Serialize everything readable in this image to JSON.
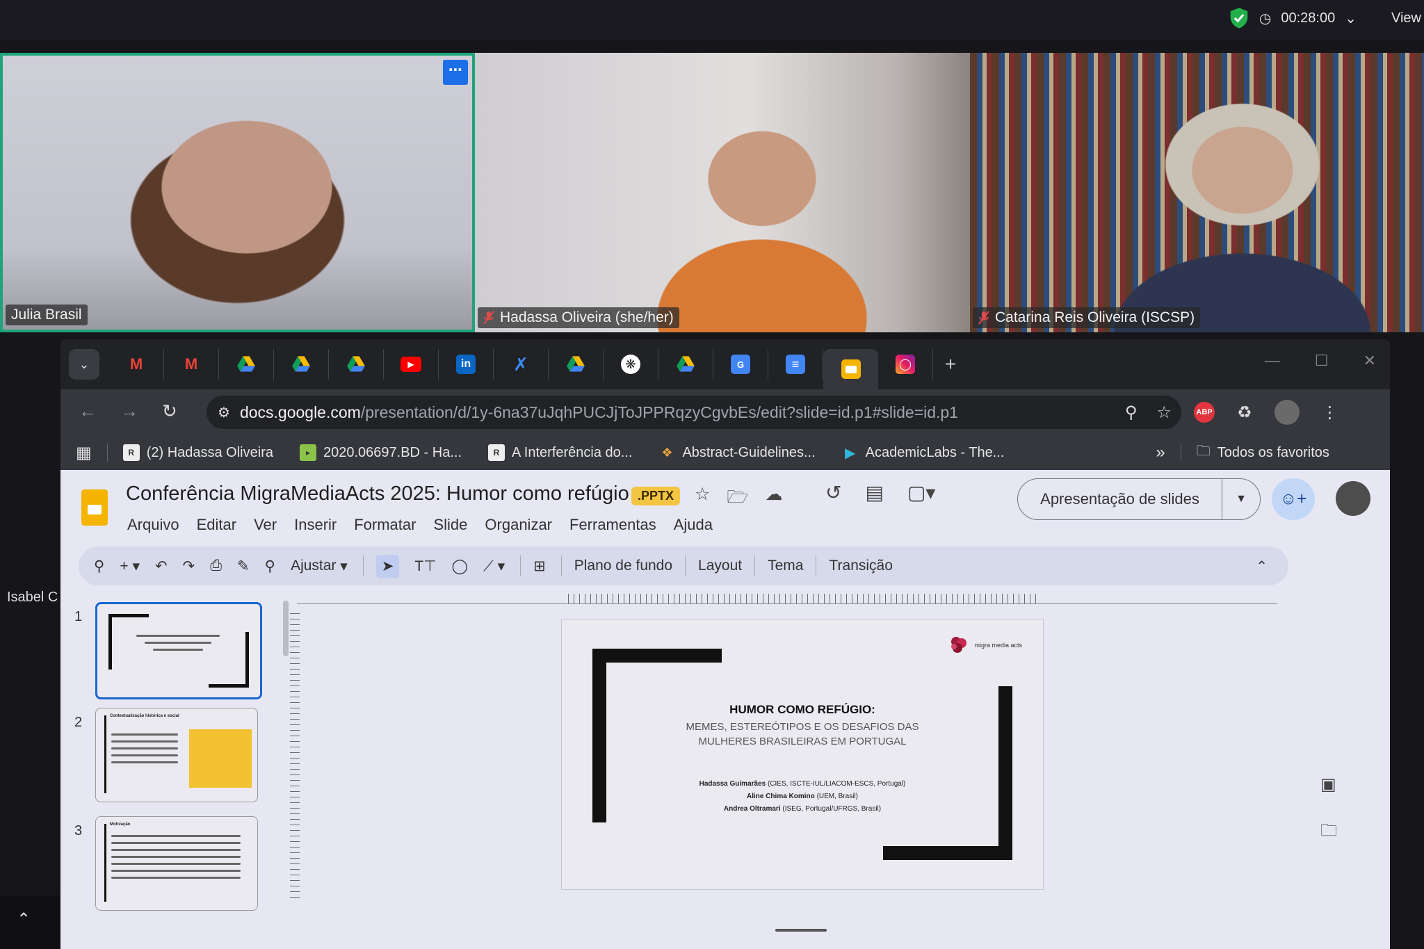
{
  "meeting": {
    "timer": "00:28:00",
    "view_label": "View",
    "participants": [
      {
        "name": "Julia Brasil"
      },
      {
        "name": "Hadassa Oliveira (she/her)"
      },
      {
        "name": "Catarina Reis Oliveira (ISCSP)"
      }
    ],
    "offscreen_participant": "Isabel C",
    "colors": {
      "active_border": "#1fa37a",
      "menu_button": "#1c6fe8"
    }
  },
  "browser": {
    "url_host": "docs.google.com",
    "url_path": "/presentation/d/1y-6na37uJqhPUCJjToJPPRqzyCgvbEs/edit?slide=id.p1#slide=id.p1",
    "tabs": [
      {
        "icon": "gmail-icon"
      },
      {
        "icon": "gmail-icon"
      },
      {
        "icon": "drive-icon"
      },
      {
        "icon": "drive-icon"
      },
      {
        "icon": "drive-icon"
      },
      {
        "icon": "youtube-icon"
      },
      {
        "icon": "linkedin-icon"
      },
      {
        "icon": "confluence-icon"
      },
      {
        "icon": "drive-icon"
      },
      {
        "icon": "chatgpt-icon"
      },
      {
        "icon": "drive-icon"
      },
      {
        "icon": "translate-icon"
      },
      {
        "icon": "docs-icon"
      },
      {
        "icon": "slides-icon",
        "active": true
      },
      {
        "icon": "instagram-icon"
      }
    ],
    "extension_abp": "ABP",
    "bookmarks": [
      {
        "label": "(2) Hadassa Oliveira"
      },
      {
        "label": "2020.06697.BD - Ha..."
      },
      {
        "label": "A Interferência do..."
      },
      {
        "label": "Abstract-Guidelines..."
      },
      {
        "label": "AcademicLabs - The..."
      }
    ],
    "all_bookmarks": "Todos os favoritos"
  },
  "docs": {
    "title": "Conferência MigraMediaActs 2025: Humor como refúgio",
    "badge": ".PPTX",
    "menu": [
      "Arquivo",
      "Editar",
      "Ver",
      "Inserir",
      "Formatar",
      "Slide",
      "Organizar",
      "Ferramentas",
      "Ajuda"
    ],
    "present_label": "Apresentação de slides",
    "toolbar": {
      "zoom_label": "Ajustar",
      "items": [
        "Plano de fundo",
        "Layout",
        "Tema",
        "Transição"
      ]
    },
    "thumbnails": [
      {
        "number": "1"
      },
      {
        "number": "2",
        "title": "Contextualização histórica e social"
      },
      {
        "number": "3",
        "title": "Motivação"
      }
    ],
    "slide": {
      "logo_text": "migra media acts",
      "title": "HUMOR COMO REFÚGIO:",
      "subtitle_line1": "MEMES, ESTEREÓTIPOS E OS DESAFIOS DAS",
      "subtitle_line2": "MULHERES BRASILEIRAS EM PORTUGAL",
      "authors": [
        {
          "name": "Hadassa Guimarães",
          "affiliation": "(CIES, ISCTE-IUL/LIACOM-ESCS, Portugal)"
        },
        {
          "name": "Aline Chima Komino",
          "affiliation": "(UEM, Brasil)"
        },
        {
          "name": "Andrea Oltramari",
          "affiliation": "(ISEG, Portugal/UFRGS, Brasil)"
        }
      ]
    }
  }
}
